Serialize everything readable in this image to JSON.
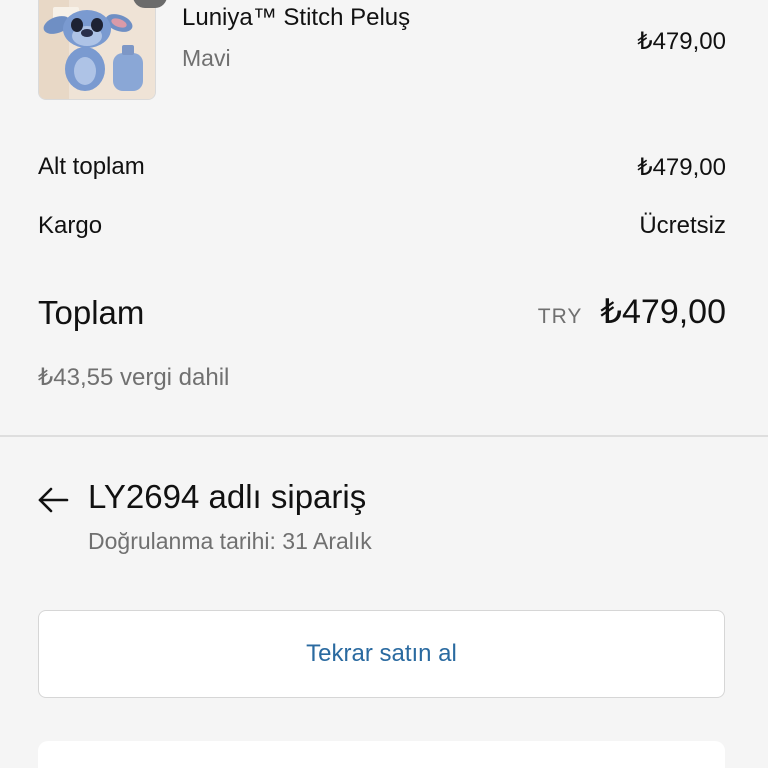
{
  "product": {
    "name": "Luniya™ Stitch Peluş",
    "variant": "Mavi",
    "price": "₺479,00",
    "image_icon": "stitch-plush-image"
  },
  "summary": {
    "subtotal_label": "Alt toplam",
    "subtotal_value": "₺479,00",
    "shipping_label": "Kargo",
    "shipping_value": "Ücretsiz",
    "total_label": "Toplam",
    "total_currency": "TRY",
    "total_value": "₺479,00",
    "tax_note": "₺43,55 vergi dahil"
  },
  "order": {
    "back_icon": "arrow-left-icon",
    "title": "LY2694 adlı sipariş",
    "confirmed_date": "Doğrulanma tarihi: 31 Aralık"
  },
  "actions": {
    "buy_again_label": "Tekrar satın al"
  },
  "colors": {
    "background": "#f5f5f5",
    "link_blue": "#2a6aa0",
    "muted_text": "#707070"
  }
}
